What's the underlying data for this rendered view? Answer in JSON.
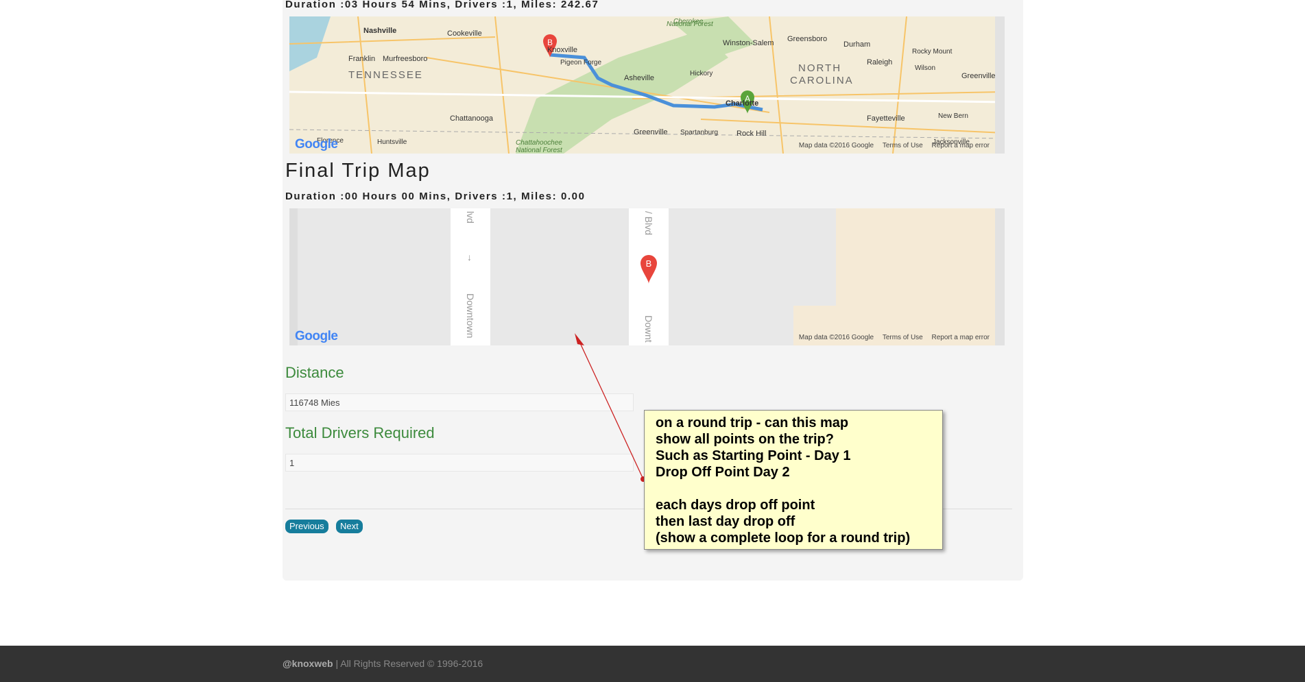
{
  "route_map": {
    "duration": "Duration :03 Hours 54 Mins, Drivers :1, Miles: 242.67",
    "places": [
      "Nashville",
      "Cookeville",
      "Knoxville",
      "Pigeon Forge",
      "Winston-Salem",
      "Greensboro",
      "Durham",
      "Rocky Mount",
      "Raleigh",
      "Wilson",
      "Greenville",
      "Franklin",
      "Murfreesboro",
      "TENNESSEE",
      "Asheville",
      "Hickory",
      "NORTH",
      "CAROLINA",
      "Charlotte",
      "Chattanooga",
      "Fayetteville",
      "Greenville",
      "Spartanburg",
      "Rock Hill",
      "New Bern",
      "Jacksonville",
      "Florence",
      "Huntsville",
      "Chattahoochee",
      "National Forest",
      "Cherokee",
      "National Forest"
    ],
    "markers": {
      "start": "A",
      "end": "B"
    },
    "footer": {
      "data": "Map data ©2016 Google",
      "terms": "Terms of Use",
      "report": "Report a map error"
    },
    "logo": "Google"
  },
  "final_map": {
    "title": "Final Trip Map",
    "duration": "Duration :00 Hours 00 Mins, Drivers :1, Miles: 0.00",
    "streets": [
      "lvd",
      "Downtown",
      "/ Blvd",
      "Downt"
    ],
    "marker": "B",
    "footer": {
      "data": "Map data ©2016 Google",
      "terms": "Terms of Use",
      "report": "Report a map error"
    },
    "logo": "Google"
  },
  "distance": {
    "label": "Distance",
    "value": "116748 Mies"
  },
  "drivers": {
    "label": "Total Drivers Required",
    "value": "1"
  },
  "buttons": {
    "previous": "Previous",
    "next": "Next"
  },
  "annotation": [
    "on a round trip - can this map",
    "show all points on the trip?",
    "Such as Starting Point - Day 1",
    "Drop Off Point Day 2",
    "",
    "each days drop off point",
    "then last day drop off",
    "(show a complete loop for a round trip)"
  ],
  "footer": {
    "brand": "@knoxweb",
    "rights": " | All Rights Reserved © 1996-2016"
  },
  "colors": {
    "accent_green": "#3c8a3c",
    "button_blue": "#167d9c",
    "note_bg": "#ffffcc",
    "marker_red": "#e8453c",
    "marker_green": "#4caf50"
  }
}
